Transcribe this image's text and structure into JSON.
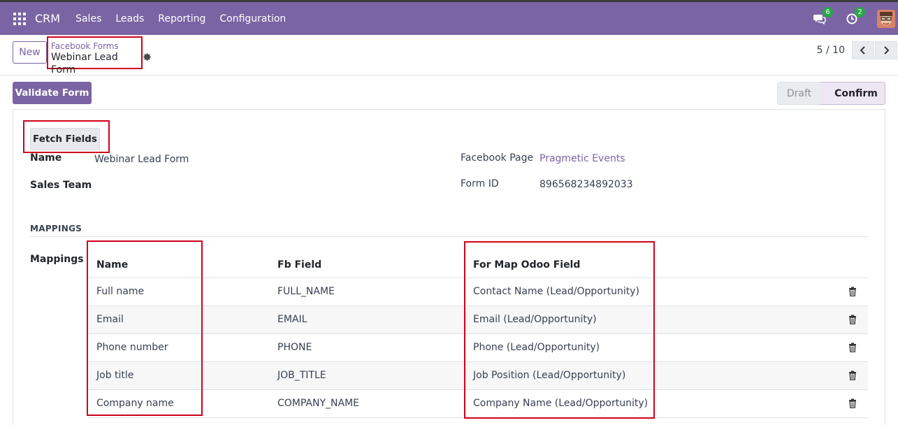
{
  "navbar": {
    "brand": "CRM",
    "menu": [
      "Sales",
      "Leads",
      "Reporting",
      "Configuration"
    ],
    "messages_count": "6",
    "activities_count": "2",
    "bg_color": "#7a64a3"
  },
  "control_panel": {
    "new_label": "New",
    "breadcrumb_parent": "Facebook Forms",
    "breadcrumb_current": "Webinar Lead Form",
    "pager_value": "5 / 10"
  },
  "statusbar": {
    "validate_label": "Validate Form",
    "stages": [
      "Draft",
      "Confirm"
    ],
    "active_stage": "Confirm"
  },
  "form": {
    "fetch_label": "Fetch Fields",
    "name_label": "Name",
    "name_value": "Webinar Lead Form",
    "sales_team_label": "Sales Team",
    "facebook_page_label": "Facebook Page",
    "facebook_page_value": "Pragmetic Events",
    "form_id_label": "Form ID",
    "form_id_value": "896568234892033",
    "section_title": "MAPPINGS",
    "mappings_label": "Mappings"
  },
  "mappings": {
    "headers": [
      "Name",
      "Fb Field",
      "For Map Odoo Field"
    ],
    "rows": [
      [
        "Full name",
        "FULL_NAME",
        "Contact Name (Lead/Opportunity)"
      ],
      [
        "Email",
        "EMAIL",
        "Email (Lead/Opportunity)"
      ],
      [
        "Phone number",
        "PHONE",
        "Phone (Lead/Opportunity)"
      ],
      [
        "Job title",
        "JOB_TITLE",
        "Job Position (Lead/Opportunity)"
      ],
      [
        "Company name",
        "COMPANY_NAME",
        "Company Name (Lead/Opportunity)"
      ]
    ]
  },
  "colors": {
    "primary": "#7a64a3",
    "highlight_box": "#d0021b",
    "badge": "#28a745"
  }
}
